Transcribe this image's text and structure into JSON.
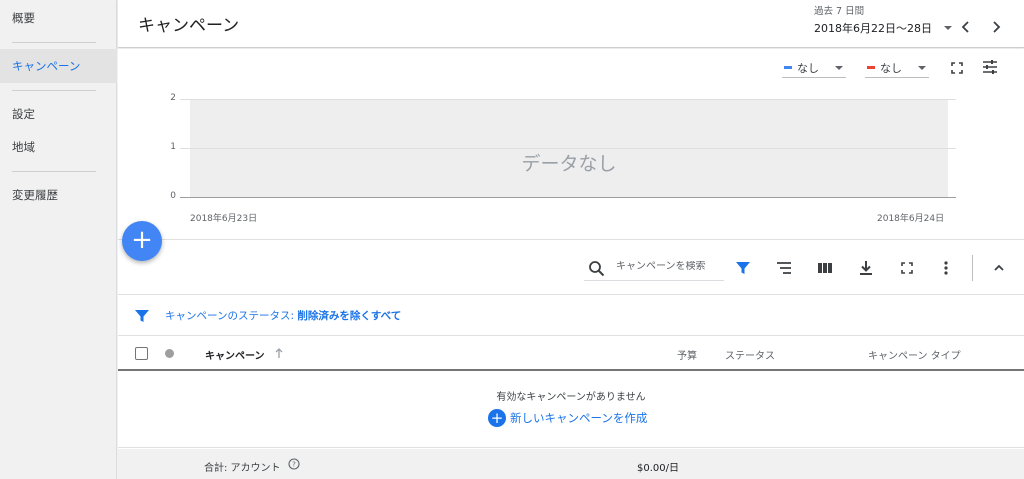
{
  "sidebar": {
    "items": [
      {
        "label": "概要"
      },
      {
        "label": "キャンペーン"
      },
      {
        "label": "設定"
      },
      {
        "label": "地域"
      },
      {
        "label": "変更履歴"
      }
    ]
  },
  "header": {
    "title": "キャンペーン",
    "date_caption": "過去 7 日間",
    "date_range": "2018年6月22日〜28日"
  },
  "chart": {
    "metric1_label": "なし",
    "metric1_color": "#4285f4",
    "metric2_label": "なし",
    "metric2_color": "#ea4335",
    "no_data": "データなし",
    "y_ticks": [
      "2",
      "1",
      "0"
    ],
    "x_start": "2018年6月23日",
    "x_end": "2018年6月24日"
  },
  "toolbar": {
    "search_placeholder": "キャンペーンを検索"
  },
  "filter": {
    "label": "キャンペーンのステータス:",
    "value": "削除済みを除くすべて"
  },
  "table": {
    "col_campaign": "キャンペーン",
    "col_budget": "予算",
    "col_status": "ステータス",
    "col_type": "キャンペーン タイプ",
    "empty_message": "有効なキャンペーンがありません",
    "create_label": "新しいキャンペーンを作成",
    "total_label": "合計: アカウント",
    "total_budget": "$0.00/日"
  },
  "colors": {
    "accent": "#1a73e8",
    "fab": "#4285f4"
  }
}
